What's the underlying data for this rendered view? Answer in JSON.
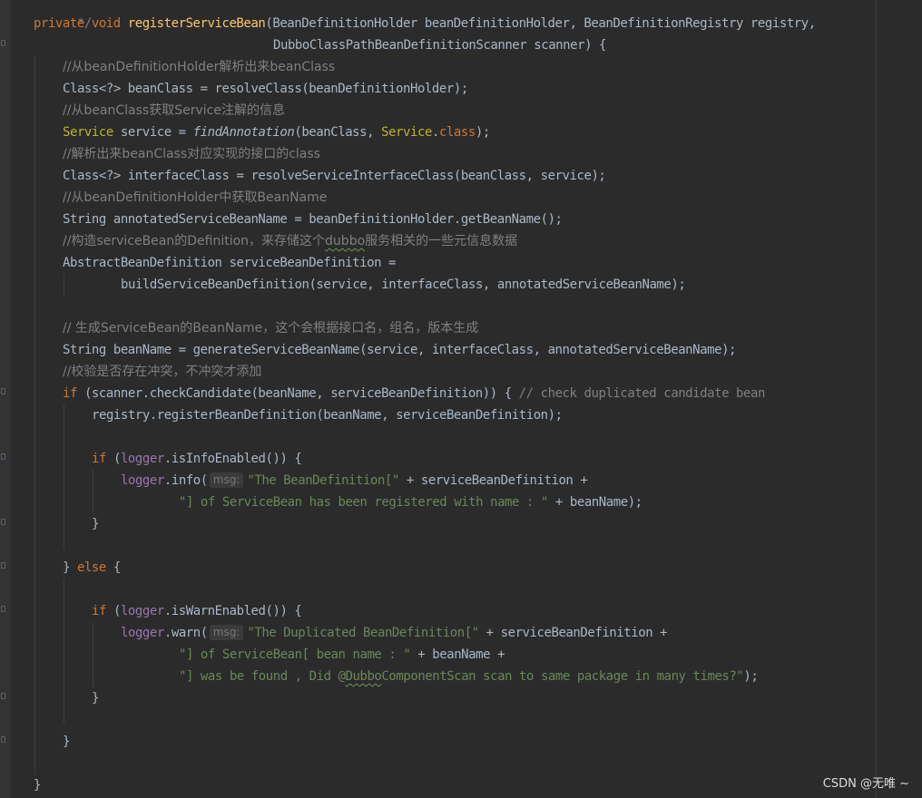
{
  "editor": {
    "lines": {
      "l0": {
        "comment_end": "*/"
      },
      "l1": {
        "kw_private": "private",
        "kw_void": "void",
        "method_name": "registerServiceBean",
        "params": "(BeanDefinitionHolder beanDefinitionHolder, BeanDefinitionRegistry registry,"
      },
      "l2": {
        "text": "DubboClassPathBeanDefinitionScanner scanner) {"
      },
      "l3": {
        "comment": "//从beanDefinitionHolder解析出来beanClass"
      },
      "l4": {
        "text": "Class<?> beanClass = resolveClass(beanDefinitionHolder);"
      },
      "l5": {
        "comment": "//从beanClass获取Service注解的信息"
      },
      "l6": {
        "type1": "Service",
        "t1": " service = ",
        "fn_call": "findAnnotation",
        "t2": "(beanClass, ",
        "type2": "Service",
        "dot": ".",
        "kw_class": "class",
        "t3": ");"
      },
      "l7": {
        "comment": "//解析出来beanClass对应实现的接口的class"
      },
      "l8": {
        "text": "Class<?> interfaceClass = resolveServiceInterfaceClass(beanClass, service);"
      },
      "l9": {
        "comment": "//从beanDefinitionHolder中获取BeanName"
      },
      "l10": {
        "text": "String annotatedServiceBeanName = beanDefinitionHolder.getBeanName();"
      },
      "l11": {
        "comment_a": "//构造serviceBean的Definition，来存储这个",
        "comment_dubbo": "dubbo",
        "comment_b": "服务相关的一些元信息数据"
      },
      "l12": {
        "text": "AbstractBeanDefinition serviceBeanDefinition ="
      },
      "l13": {
        "text": "buildServiceBeanDefinition(service, interfaceClass, annotatedServiceBeanName);"
      },
      "l15": {
        "comment": "// 生成ServiceBean的BeanName，这个会根据接口名，组名，版本生成"
      },
      "l16": {
        "text": "String beanName = generateServiceBeanName(service, interfaceClass, annotatedServiceBeanName);"
      },
      "l17": {
        "comment": "//校验是否存在冲突，不冲突才添加"
      },
      "l18": {
        "kw_if": "if",
        "text": " (scanner.checkCandidate(beanName, serviceBeanDefinition)) { ",
        "comment": "// check duplicated candidate bean"
      },
      "l19": {
        "text": "registry.registerBeanDefinition(beanName, serviceBeanDefinition);"
      },
      "l21": {
        "kw_if": "if",
        "t1": " (",
        "field": "logger",
        "t2": ".isInfoEnabled()) {"
      },
      "l22": {
        "field": "logger",
        "t1": ".info(",
        "hint": "msg:",
        "str": "\"The BeanDefinition[\"",
        "t2": " + serviceBeanDefinition +"
      },
      "l23": {
        "str": "\"] of ServiceBean has been registered with name : \"",
        "t1": " + beanName);"
      },
      "l24": {
        "text": "}"
      },
      "l26": {
        "brace": "} ",
        "kw_else": "else",
        "t1": " {"
      },
      "l28": {
        "kw_if": "if",
        "t1": " (",
        "field": "logger",
        "t2": ".isWarnEnabled()) {"
      },
      "l29": {
        "field": "logger",
        "t1": ".warn(",
        "hint": "msg:",
        "str": "\"The Duplicated BeanDefinition[\"",
        "t2": " + serviceBeanDefinition +"
      },
      "l30": {
        "str": "\"] of ServiceBean[ bean name : \"",
        "t1": " + beanName +"
      },
      "l31": {
        "str_a": "\"] was be found , Did @",
        "str_dubbo": "Dubbo",
        "str_b": "ComponentScan scan to same package in many times?\"",
        "t1": ");"
      },
      "l32": {
        "text": "}"
      },
      "l34": {
        "text": "}"
      },
      "l36": {
        "text": "}"
      }
    }
  },
  "watermark": "CSDN @无唯 ~",
  "colors": {
    "background": "#2b2b2b",
    "keyword": "#cc7832",
    "method": "#ffc66d",
    "comment": "#808080",
    "string": "#6a8759",
    "default_text": "#a9b7c6",
    "annotation_type": "#bbb529",
    "field": "#9876aa"
  }
}
